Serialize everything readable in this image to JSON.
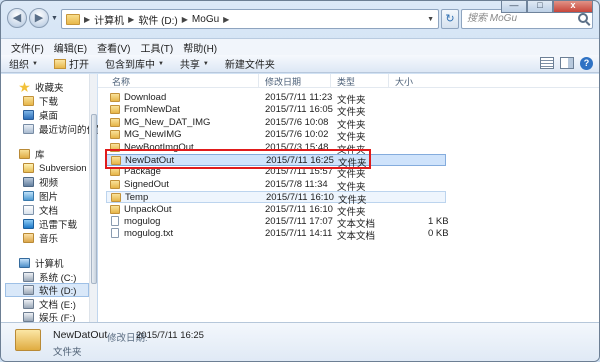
{
  "address": {
    "segments": [
      "计算机",
      "软件 (D:)",
      "MoGu"
    ]
  },
  "search": {
    "placeholder": "搜索 MoGu"
  },
  "window_controls": {
    "minimize": "—",
    "maximize": "□",
    "close": "x"
  },
  "menu": [
    "文件(F)",
    "编辑(E)",
    "查看(V)",
    "工具(T)",
    "帮助(H)"
  ],
  "commands": {
    "organize": "组织",
    "open": "打开",
    "include_library": "包含到库中",
    "share": "共享",
    "new_folder": "新建文件夹"
  },
  "nav": {
    "favorites": "收藏夹",
    "downloads": "下载",
    "desktop": "桌面",
    "recent": "最近访问的位置",
    "libraries": "库",
    "subversion": "Subversion",
    "videos": "视频",
    "pictures": "图片",
    "documents": "文档",
    "thunder": "迅雷下载",
    "music": "音乐",
    "computer": "计算机",
    "drive_c": "系统 (C:)",
    "drive_d": "软件 (D:)",
    "drive_e": "文档 (E:)",
    "drive_f": "娱乐 (F:)"
  },
  "columns": {
    "name": "名称",
    "modified": "修改日期",
    "type": "类型",
    "size": "大小"
  },
  "files": [
    {
      "name": "Download",
      "date": "2015/7/11 11:23",
      "type": "文件夹",
      "size": "",
      "kind": "folder"
    },
    {
      "name": "FromNewDat",
      "date": "2015/7/11 16:05",
      "type": "文件夹",
      "size": "",
      "kind": "folder"
    },
    {
      "name": "MG_New_DAT_IMG",
      "date": "2015/7/6 10:08",
      "type": "文件夹",
      "size": "",
      "kind": "folder"
    },
    {
      "name": "MG_NewIMG",
      "date": "2015/7/6 10:02",
      "type": "文件夹",
      "size": "",
      "kind": "folder"
    },
    {
      "name": "NewBootImgOut",
      "date": "2015/7/3 15:48",
      "type": "文件夹",
      "size": "",
      "kind": "folder"
    },
    {
      "name": "NewDatOut",
      "date": "2015/7/11 16:25",
      "type": "文件夹",
      "size": "",
      "kind": "folder",
      "selected": true
    },
    {
      "name": "Package",
      "date": "2015/7/11 15:57",
      "type": "文件夹",
      "size": "",
      "kind": "folder"
    },
    {
      "name": "SignedOut",
      "date": "2015/7/8 11:34",
      "type": "文件夹",
      "size": "",
      "kind": "folder"
    },
    {
      "name": "Temp",
      "date": "2015/7/11 16:10",
      "type": "文件夹",
      "size": "",
      "kind": "folder",
      "hover": true
    },
    {
      "name": "UnpackOut",
      "date": "2015/7/11 16:10",
      "type": "文件夹",
      "size": "",
      "kind": "folder"
    },
    {
      "name": "mogulog",
      "date": "2015/7/11 17:07",
      "type": "文本文档",
      "size": "1 KB",
      "kind": "file"
    },
    {
      "name": "mogulog.txt",
      "date": "2015/7/11 14:11",
      "type": "文本文档",
      "size": "0 KB",
      "kind": "file"
    }
  ],
  "details": {
    "name": "NewDatOut",
    "modified_label": "修改日期:",
    "modified": "2015/7/11 16:25",
    "type": "文件夹"
  }
}
